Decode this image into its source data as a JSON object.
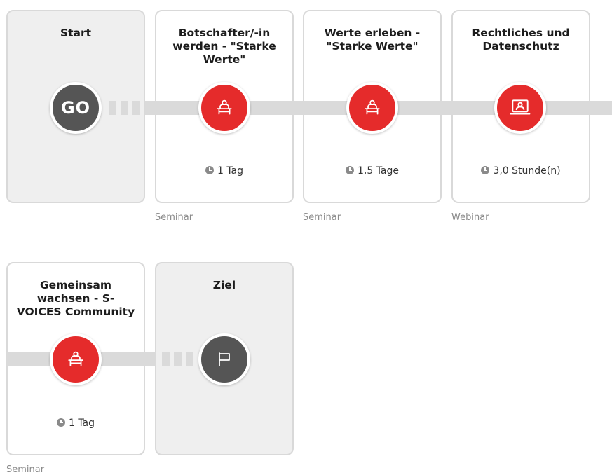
{
  "colors": {
    "accent_red": "#e52b2b",
    "node_dark": "#555555",
    "connector": "#dadada",
    "endpoint_card": "#efefef"
  },
  "row1": {
    "start": {
      "title": "Start",
      "node_text": "GO"
    },
    "cards": [
      {
        "title": "Botschafter/-in werden - \"Starke Werte\"",
        "icon": "seminar-person-desk-icon",
        "duration": "1 Tag",
        "type": "Seminar"
      },
      {
        "title": "Werte erleben - \"Starke Werte\"",
        "icon": "seminar-person-desk-icon",
        "duration": "1,5 Tage",
        "type": "Seminar"
      },
      {
        "title": "Rechtliches und Datenschutz",
        "icon": "webinar-laptop-icon",
        "duration": "3,0 Stunde(n)",
        "type": "Webinar"
      }
    ]
  },
  "row2": {
    "cards": [
      {
        "title": "Gemeinsam wachsen - S-VOICES Community",
        "icon": "seminar-person-desk-icon",
        "duration": "1 Tag",
        "type": "Seminar"
      }
    ],
    "end": {
      "title": "Ziel",
      "icon": "flag-icon"
    }
  }
}
